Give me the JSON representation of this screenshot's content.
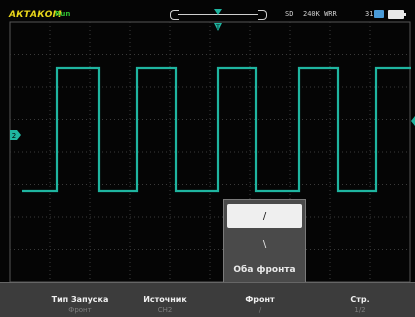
{
  "header": {
    "brand": "АКТАКОМ",
    "run_state": "Run",
    "acq_mode": "SD",
    "sample_rate": "240K WRR",
    "time_label": "31"
  },
  "colors": {
    "trace": "#1fb5a0",
    "brand": "#e8d51a",
    "run": "#2fbf2f",
    "grid": "#3a3a3a"
  },
  "channel_marker": "2",
  "trigger_marker": "T",
  "edge_menu": {
    "options": [
      {
        "icon": "rising-edge-icon",
        "symbol": "/",
        "selected": true
      },
      {
        "icon": "falling-edge-icon",
        "symbol": "\\",
        "selected": false
      }
    ],
    "both_label": "Оба фронта"
  },
  "softkeys": [
    {
      "label": "Тип Запуска",
      "value": "Фронт"
    },
    {
      "label": "Источник",
      "value": "CH2"
    },
    {
      "label": "Фронт",
      "value": "/"
    },
    {
      "label": "Стр.",
      "value": "1/2"
    }
  ]
}
